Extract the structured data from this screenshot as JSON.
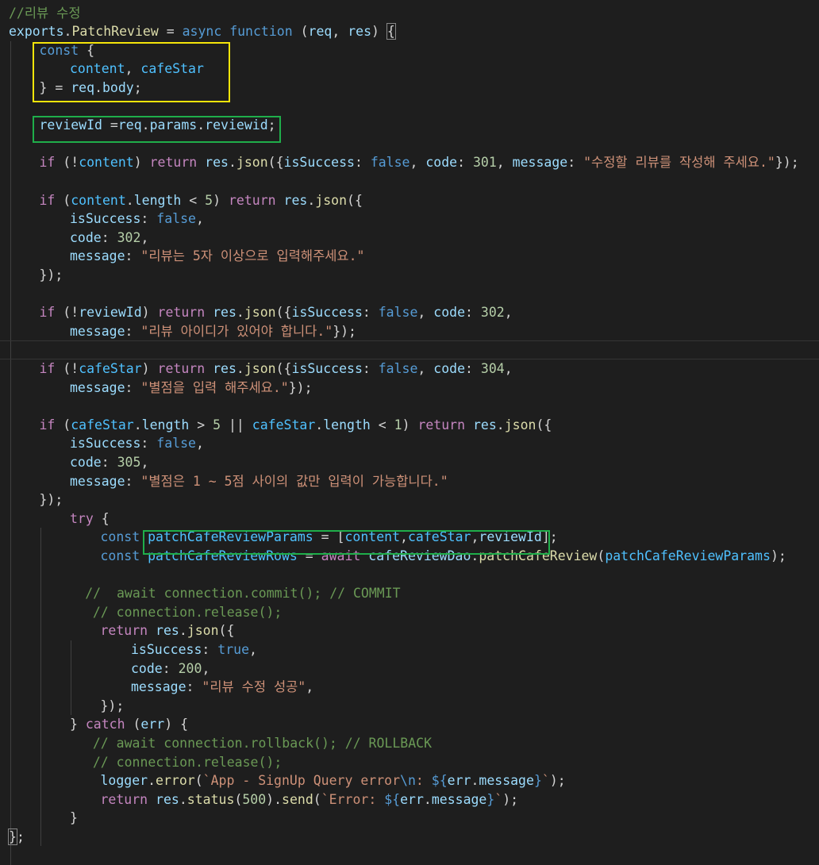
{
  "editor": {
    "lines": [
      {
        "indent": 0,
        "tokens": [
          [
            "cm",
            "//리뷰 수정"
          ]
        ]
      },
      {
        "indent": 0,
        "tokens": [
          [
            "v",
            "exports"
          ],
          [
            "p",
            "."
          ],
          [
            "f",
            "PatchReview"
          ],
          [
            "p",
            " = "
          ],
          [
            "k",
            "async"
          ],
          [
            "p",
            " "
          ],
          [
            "k",
            "function"
          ],
          [
            "p",
            " ("
          ],
          [
            "v",
            "req"
          ],
          [
            "p",
            ", "
          ],
          [
            "v",
            "res"
          ],
          [
            "p",
            ") "
          ],
          [
            "p",
            "{"
          ]
        ]
      },
      {
        "indent": 1,
        "tokens": [
          [
            "k",
            "const"
          ],
          [
            "p",
            " {"
          ]
        ]
      },
      {
        "indent": 2,
        "tokens": [
          [
            "pv",
            "content"
          ],
          [
            "p",
            ", "
          ],
          [
            "pv",
            "cafeStar"
          ]
        ]
      },
      {
        "indent": 1,
        "tokens": [
          [
            "p",
            "} = "
          ],
          [
            "v",
            "req"
          ],
          [
            "p",
            "."
          ],
          [
            "v",
            "body"
          ],
          [
            "p",
            ";"
          ]
        ]
      },
      {
        "indent": 0,
        "tokens": []
      },
      {
        "indent": 1,
        "tokens": [
          [
            "v",
            "reviewId"
          ],
          [
            "p",
            " ="
          ],
          [
            "v",
            "req"
          ],
          [
            "p",
            "."
          ],
          [
            "v",
            "params"
          ],
          [
            "p",
            "."
          ],
          [
            "v",
            "reviewid"
          ],
          [
            "p",
            ";"
          ]
        ]
      },
      {
        "indent": 0,
        "tokens": []
      },
      {
        "indent": 1,
        "tokens": [
          [
            "c",
            "if"
          ],
          [
            "p",
            " (!"
          ],
          [
            "pv",
            "content"
          ],
          [
            "p",
            ") "
          ],
          [
            "c",
            "return"
          ],
          [
            "p",
            " "
          ],
          [
            "v",
            "res"
          ],
          [
            "p",
            "."
          ],
          [
            "f",
            "json"
          ],
          [
            "p",
            "({"
          ],
          [
            "v",
            "isSuccess"
          ],
          [
            "p",
            ": "
          ],
          [
            "k",
            "false"
          ],
          [
            "p",
            ", "
          ],
          [
            "v",
            "code"
          ],
          [
            "p",
            ": "
          ],
          [
            "n",
            "301"
          ],
          [
            "p",
            ", "
          ],
          [
            "v",
            "message"
          ],
          [
            "p",
            ": "
          ],
          [
            "s",
            "\"수정할 리뷰를 작성해 주세요.\""
          ],
          [
            "p",
            "});"
          ]
        ]
      },
      {
        "indent": 0,
        "tokens": []
      },
      {
        "indent": 1,
        "tokens": [
          [
            "c",
            "if"
          ],
          [
            "p",
            " ("
          ],
          [
            "pv",
            "content"
          ],
          [
            "p",
            "."
          ],
          [
            "v",
            "length"
          ],
          [
            "p",
            " < "
          ],
          [
            "n",
            "5"
          ],
          [
            "p",
            ") "
          ],
          [
            "c",
            "return"
          ],
          [
            "p",
            " "
          ],
          [
            "v",
            "res"
          ],
          [
            "p",
            "."
          ],
          [
            "f",
            "json"
          ],
          [
            "p",
            "({"
          ]
        ]
      },
      {
        "indent": 2,
        "tokens": [
          [
            "v",
            "isSuccess"
          ],
          [
            "p",
            ": "
          ],
          [
            "k",
            "false"
          ],
          [
            "p",
            ","
          ]
        ]
      },
      {
        "indent": 2,
        "tokens": [
          [
            "v",
            "code"
          ],
          [
            "p",
            ": "
          ],
          [
            "n",
            "302"
          ],
          [
            "p",
            ","
          ]
        ]
      },
      {
        "indent": 2,
        "tokens": [
          [
            "v",
            "message"
          ],
          [
            "p",
            ": "
          ],
          [
            "s",
            "\"리뷰는 5자 이상으로 입력해주세요.\""
          ]
        ]
      },
      {
        "indent": 1,
        "tokens": [
          [
            "p",
            "});"
          ]
        ]
      },
      {
        "indent": 0,
        "tokens": []
      },
      {
        "indent": 1,
        "tokens": [
          [
            "c",
            "if"
          ],
          [
            "p",
            " (!"
          ],
          [
            "v",
            "reviewId"
          ],
          [
            "p",
            ") "
          ],
          [
            "c",
            "return"
          ],
          [
            "p",
            " "
          ],
          [
            "v",
            "res"
          ],
          [
            "p",
            "."
          ],
          [
            "f",
            "json"
          ],
          [
            "p",
            "({"
          ],
          [
            "v",
            "isSuccess"
          ],
          [
            "p",
            ": "
          ],
          [
            "k",
            "false"
          ],
          [
            "p",
            ", "
          ],
          [
            "v",
            "code"
          ],
          [
            "p",
            ": "
          ],
          [
            "n",
            "302"
          ],
          [
            "p",
            ","
          ]
        ]
      },
      {
        "indent": 2,
        "tokens": [
          [
            "v",
            "message"
          ],
          [
            "p",
            ": "
          ],
          [
            "s",
            "\"리뷰 아이디가 있어야 합니다.\""
          ],
          [
            "p",
            "});"
          ]
        ]
      },
      {
        "indent": 1,
        "tokens": [],
        "current": true
      },
      {
        "indent": 1,
        "tokens": [
          [
            "c",
            "if"
          ],
          [
            "p",
            " (!"
          ],
          [
            "pv",
            "cafeStar"
          ],
          [
            "p",
            ") "
          ],
          [
            "c",
            "return"
          ],
          [
            "p",
            " "
          ],
          [
            "v",
            "res"
          ],
          [
            "p",
            "."
          ],
          [
            "f",
            "json"
          ],
          [
            "p",
            "({"
          ],
          [
            "v",
            "isSuccess"
          ],
          [
            "p",
            ": "
          ],
          [
            "k",
            "false"
          ],
          [
            "p",
            ", "
          ],
          [
            "v",
            "code"
          ],
          [
            "p",
            ": "
          ],
          [
            "n",
            "304"
          ],
          [
            "p",
            ","
          ]
        ]
      },
      {
        "indent": 2,
        "tokens": [
          [
            "v",
            "message"
          ],
          [
            "p",
            ": "
          ],
          [
            "s",
            "\"별점을 입력 해주세요.\""
          ],
          [
            "p",
            "});"
          ]
        ]
      },
      {
        "indent": 0,
        "tokens": []
      },
      {
        "indent": 1,
        "tokens": [
          [
            "c",
            "if"
          ],
          [
            "p",
            " ("
          ],
          [
            "pv",
            "cafeStar"
          ],
          [
            "p",
            "."
          ],
          [
            "v",
            "length"
          ],
          [
            "p",
            " > "
          ],
          [
            "n",
            "5"
          ],
          [
            "p",
            " || "
          ],
          [
            "pv",
            "cafeStar"
          ],
          [
            "p",
            "."
          ],
          [
            "v",
            "length"
          ],
          [
            "p",
            " < "
          ],
          [
            "n",
            "1"
          ],
          [
            "p",
            ") "
          ],
          [
            "c",
            "return"
          ],
          [
            "p",
            " "
          ],
          [
            "v",
            "res"
          ],
          [
            "p",
            "."
          ],
          [
            "f",
            "json"
          ],
          [
            "p",
            "({"
          ]
        ]
      },
      {
        "indent": 2,
        "tokens": [
          [
            "v",
            "isSuccess"
          ],
          [
            "p",
            ": "
          ],
          [
            "k",
            "false"
          ],
          [
            "p",
            ","
          ]
        ]
      },
      {
        "indent": 2,
        "tokens": [
          [
            "v",
            "code"
          ],
          [
            "p",
            ": "
          ],
          [
            "n",
            "305"
          ],
          [
            "p",
            ","
          ]
        ]
      },
      {
        "indent": 2,
        "tokens": [
          [
            "v",
            "message"
          ],
          [
            "p",
            ": "
          ],
          [
            "s",
            "\"별점은 1 ~ 5점 사이의 값만 입력이 가능합니다.\""
          ]
        ]
      },
      {
        "indent": 1,
        "tokens": [
          [
            "p",
            "});"
          ]
        ]
      },
      {
        "indent": 2,
        "tokens": [
          [
            "c",
            "try"
          ],
          [
            "p",
            " {"
          ]
        ]
      },
      {
        "indent": 3,
        "tokens": [
          [
            "k",
            "const"
          ],
          [
            "p",
            " "
          ],
          [
            "pv",
            "patchCafeReviewParams"
          ],
          [
            "p",
            " = ["
          ],
          [
            "pv",
            "content"
          ],
          [
            "p",
            ","
          ],
          [
            "pv",
            "cafeStar"
          ],
          [
            "p",
            ","
          ],
          [
            "v",
            "reviewId"
          ],
          [
            "p",
            "];"
          ]
        ]
      },
      {
        "indent": 3,
        "tokens": [
          [
            "k",
            "const"
          ],
          [
            "p",
            " "
          ],
          [
            "pv",
            "patchCafeReviewRows"
          ],
          [
            "p",
            " = "
          ],
          [
            "c",
            "await"
          ],
          [
            "p",
            " "
          ],
          [
            "v",
            "cafeReviewDao"
          ],
          [
            "p",
            "."
          ],
          [
            "f",
            "patchCafeReview"
          ],
          [
            "p",
            "("
          ],
          [
            "pv",
            "patchCafeReviewParams"
          ],
          [
            "p",
            ");"
          ]
        ]
      },
      {
        "indent": 0,
        "tokens": []
      },
      {
        "indent": 2.5,
        "tokens": [
          [
            "cm",
            "//  await connection.commit(); // COMMIT"
          ]
        ]
      },
      {
        "indent": 2.75,
        "tokens": [
          [
            "cm",
            "// connection.release();"
          ]
        ]
      },
      {
        "indent": 3,
        "tokens": [
          [
            "c",
            "return"
          ],
          [
            "p",
            " "
          ],
          [
            "v",
            "res"
          ],
          [
            "p",
            "."
          ],
          [
            "f",
            "json"
          ],
          [
            "p",
            "({"
          ]
        ]
      },
      {
        "indent": 4,
        "tokens": [
          [
            "v",
            "isSuccess"
          ],
          [
            "p",
            ": "
          ],
          [
            "k",
            "true"
          ],
          [
            "p",
            ","
          ]
        ]
      },
      {
        "indent": 4,
        "tokens": [
          [
            "v",
            "code"
          ],
          [
            "p",
            ": "
          ],
          [
            "n",
            "200"
          ],
          [
            "p",
            ","
          ]
        ]
      },
      {
        "indent": 4,
        "tokens": [
          [
            "v",
            "message"
          ],
          [
            "p",
            ": "
          ],
          [
            "s",
            "\"리뷰 수정 성공\""
          ],
          [
            "p",
            ","
          ]
        ]
      },
      {
        "indent": 3,
        "tokens": [
          [
            "p",
            "});"
          ]
        ]
      },
      {
        "indent": 2,
        "tokens": [
          [
            "p",
            "} "
          ],
          [
            "c",
            "catch"
          ],
          [
            "p",
            " ("
          ],
          [
            "v",
            "err"
          ],
          [
            "p",
            ") {"
          ]
        ]
      },
      {
        "indent": 2.75,
        "tokens": [
          [
            "cm",
            "// await connection.rollback(); // ROLLBACK"
          ]
        ]
      },
      {
        "indent": 2.75,
        "tokens": [
          [
            "cm",
            "// connection.release();"
          ]
        ]
      },
      {
        "indent": 3,
        "tokens": [
          [
            "v",
            "logger"
          ],
          [
            "p",
            "."
          ],
          [
            "f",
            "error"
          ],
          [
            "p",
            "("
          ],
          [
            "s",
            "`App - SignUp Query error"
          ],
          [
            "k",
            "\\n"
          ],
          [
            "s",
            ": "
          ],
          [
            "k",
            "${"
          ],
          [
            "v",
            "err"
          ],
          [
            "p",
            "."
          ],
          [
            "v",
            "message"
          ],
          [
            "k",
            "}"
          ],
          [
            "s",
            "`"
          ],
          [
            "p",
            ");"
          ]
        ]
      },
      {
        "indent": 3,
        "tokens": [
          [
            "c",
            "return"
          ],
          [
            "p",
            " "
          ],
          [
            "v",
            "res"
          ],
          [
            "p",
            "."
          ],
          [
            "f",
            "status"
          ],
          [
            "p",
            "("
          ],
          [
            "n",
            "500"
          ],
          [
            "p",
            ")."
          ],
          [
            "f",
            "send"
          ],
          [
            "p",
            "("
          ],
          [
            "s",
            "`Error: "
          ],
          [
            "k",
            "${"
          ],
          [
            "v",
            "err"
          ],
          [
            "p",
            "."
          ],
          [
            "v",
            "message"
          ],
          [
            "k",
            "}"
          ],
          [
            "s",
            "`"
          ],
          [
            "p",
            ");"
          ]
        ]
      },
      {
        "indent": 2,
        "tokens": [
          [
            "p",
            "}"
          ]
        ]
      },
      {
        "indent": 0,
        "tokens": [
          [
            "p",
            "}"
          ],
          [
            "p",
            ";"
          ]
        ]
      }
    ]
  }
}
